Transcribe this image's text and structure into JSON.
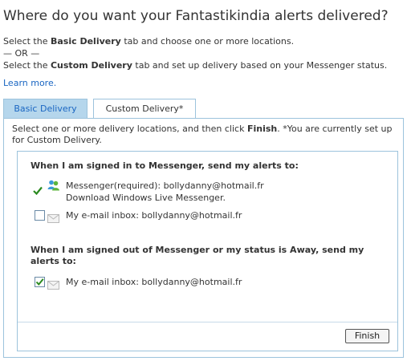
{
  "header": {
    "title": "Where do you want your Fantastikindia alerts delivered?"
  },
  "intro": {
    "line1_pre": "Select the ",
    "line1_bold": "Basic Delivery",
    "line1_post": " tab and choose one or more locations.",
    "or_separator": "— OR —",
    "line2_pre": "Select the ",
    "line2_bold": "Custom Delivery",
    "line2_post": " tab and set up delivery based on your Messenger status.",
    "learn_more": "Learn more."
  },
  "tabs": [
    {
      "label": "Basic Delivery",
      "active": false
    },
    {
      "label": "Custom Delivery*",
      "active": true
    }
  ],
  "panel": {
    "desc_pre": "Select one or more delivery locations, and then click ",
    "desc_bold": "Finish",
    "desc_post": ". *You are currently set up for Custom Delivery."
  },
  "signed_in": {
    "heading": "When I am signed in to Messenger, send my alerts to:",
    "messenger_label": "Messenger(required): bollydanny@hotmail.fr",
    "download_link": "Download Windows Live Messenger.",
    "email_label": "My e-mail inbox: bollydanny@hotmail.fr",
    "email_checked": false
  },
  "signed_out": {
    "heading": "When I am signed out of Messenger or my status is Away, send my alerts to:",
    "email_label": "My e-mail inbox: bollydanny@hotmail.fr",
    "email_checked": true
  },
  "buttons": {
    "finish": "Finish"
  },
  "colors": {
    "accent_blue": "#1a66c2",
    "tab_active_bg": "#b5d6ec",
    "border": "#9cc3dc",
    "check_green": "#2a8a1f"
  }
}
